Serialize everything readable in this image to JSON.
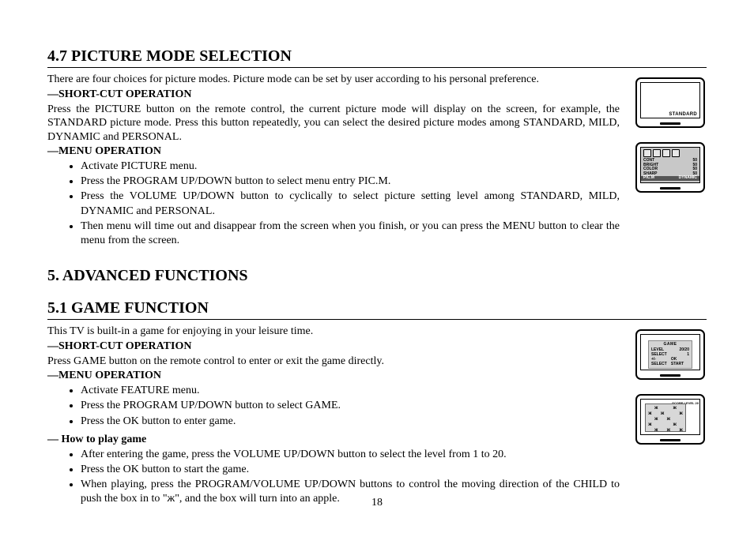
{
  "section47": {
    "heading": "4.7 PICTURE MODE SELECTION",
    "intro": "There are four choices for picture modes. Picture mode can be set by user according to his personal preference.",
    "shortcut_head": "—SHORT-CUT OPERATION",
    "shortcut_body": "Press the PICTURE button on the remote control, the current picture mode will display on the screen, for example, the STANDARD picture mode. Press this button repeatedly, you can select the desired picture modes among STANDARD, MILD, DYNAMIC and PERSONAL.",
    "menu_head": "—MENU OPERATION",
    "bullets": [
      "Activate PICTURE menu.",
      "Press the PROGRAM UP/DOWN button to select menu entry PIC.M.",
      "Press the VOLUME UP/DOWN button to cyclically to select picture setting level among STANDARD, MILD, DYNAMIC and PERSONAL.",
      "Then menu will time out and disappear from the screen when you finish, or you can press the MENU button to clear the menu from the screen."
    ]
  },
  "section5": {
    "heading": "5.   ADVANCED FUNCTIONS"
  },
  "section51": {
    "heading": "5.1 GAME FUNCTION",
    "intro": "This TV is built-in a game for enjoying in your leisure time.",
    "shortcut_head": "—SHORT-CUT OPERATION",
    "shortcut_body": "Press GAME button on the remote control to enter or exit the game directly.",
    "menu_head": "—MENU OPERATION",
    "menu_bullets": [
      "Activate FEATURE menu.",
      "Press the PROGRAM UP/DOWN button to select GAME.",
      "Press the OK button to enter game."
    ],
    "howto_head": "— How to play game",
    "howto_bullets": [
      "After entering the game, press the VOLUME UP/DOWN button to select the level from 1 to 20.",
      "Press the OK button to start the game.",
      "When playing, press the PROGRAM/VOLUME UP/DOWN buttons to control the moving direction of the CHILD to push the box in to \"ж\", and the box will turn into an apple."
    ]
  },
  "illus": {
    "standard_label": "STANDARD",
    "menu": {
      "rows": [
        {
          "k": "CONT",
          "v": "50"
        },
        {
          "k": "BRIGHT",
          "v": "50"
        },
        {
          "k": "COLOR",
          "v": "50"
        },
        {
          "k": "SHARP",
          "v": "50"
        }
      ],
      "hl_k": "PIC.M",
      "hl_v": "DYNAMIC"
    },
    "game_menu": {
      "title": "GAME",
      "level_k": "LEVEL",
      "level_v": "20/20",
      "select_k": "SELECT",
      "select_v": "1",
      "foot_l": "+/- SELECT",
      "foot_r": "OK START"
    },
    "board_side": "SCORE  LEVEL 20"
  },
  "page_number": "18"
}
